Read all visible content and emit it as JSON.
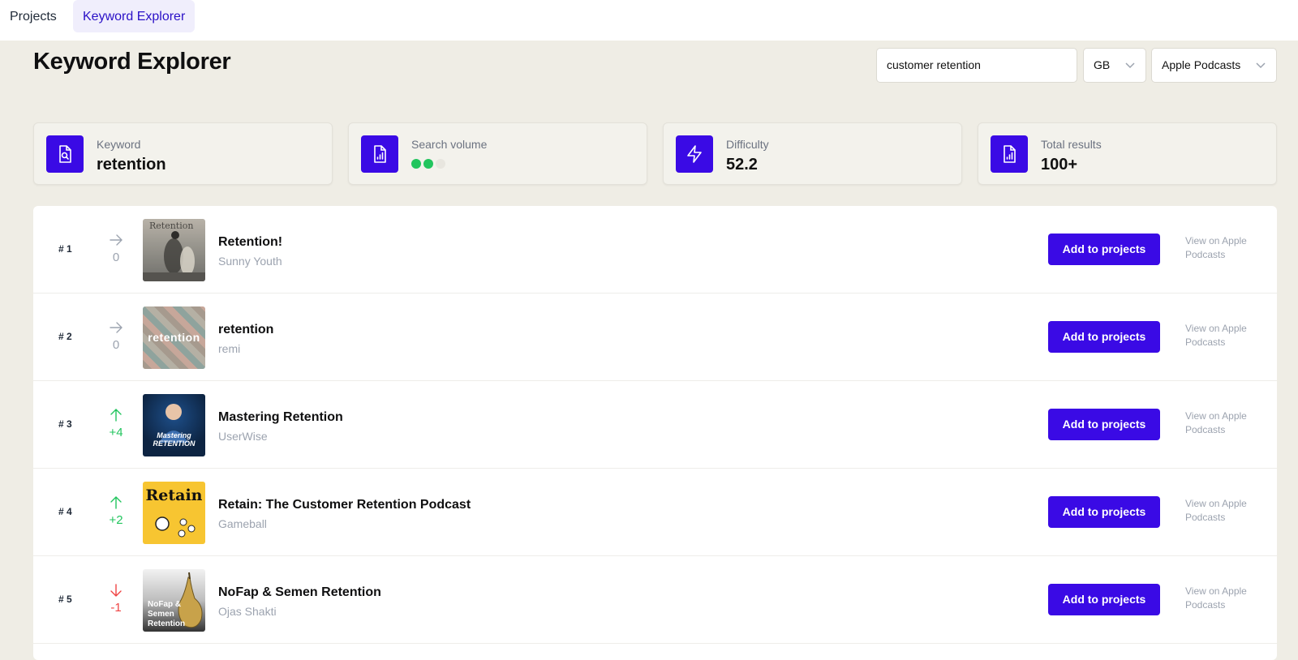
{
  "nav": {
    "tabs": [
      {
        "label": "Projects"
      },
      {
        "label": "Keyword Explorer"
      }
    ]
  },
  "header": {
    "title": "Keyword Explorer",
    "search_value": "customer retention",
    "country": "GB",
    "platform": "Apple Podcasts"
  },
  "stats": {
    "keyword": {
      "label": "Keyword",
      "value": "retention",
      "icon": "document-search-icon"
    },
    "search_volume": {
      "label": "Search volume",
      "level": 2,
      "max_level": 3,
      "icon": "document-chart-icon"
    },
    "difficulty": {
      "label": "Difficulty",
      "value": "52.2",
      "icon": "lightning-icon"
    },
    "total_results": {
      "label": "Total results",
      "value": "100+",
      "icon": "document-chart-icon"
    }
  },
  "colors": {
    "accent": "#3a0ae5",
    "up": "#22c55e",
    "down": "#ef4444",
    "flat": "#9ca3af",
    "background": "#efede5"
  },
  "results": [
    {
      "rank": "# 1",
      "direction": "flat",
      "change": "0",
      "title": "Retention!",
      "author": "Sunny Youth",
      "cover_text": "Retention",
      "add_label": "Add to projects",
      "view_label": "View on Apple Podcasts"
    },
    {
      "rank": "# 2",
      "direction": "flat",
      "change": "0",
      "title": "retention",
      "author": "remi",
      "cover_text": "retention",
      "add_label": "Add to projects",
      "view_label": "View on Apple Podcasts"
    },
    {
      "rank": "# 3",
      "direction": "up",
      "change": "+4",
      "title": "Mastering Retention",
      "author": "UserWise",
      "cover_text": "Mastering RETENTION",
      "add_label": "Add to projects",
      "view_label": "View on Apple Podcasts"
    },
    {
      "rank": "# 4",
      "direction": "up",
      "change": "+2",
      "title": "Retain: The Customer Retention Podcast",
      "author": "Gameball",
      "cover_text": "Retain",
      "add_label": "Add to projects",
      "view_label": "View on Apple Podcasts"
    },
    {
      "rank": "# 5",
      "direction": "down",
      "change": "-1",
      "title": "NoFap & Semen Retention",
      "author": "Ojas Shakti",
      "cover_text": "NoFap & Semen Retention",
      "add_label": "Add to projects",
      "view_label": "View on Apple Podcasts"
    }
  ]
}
